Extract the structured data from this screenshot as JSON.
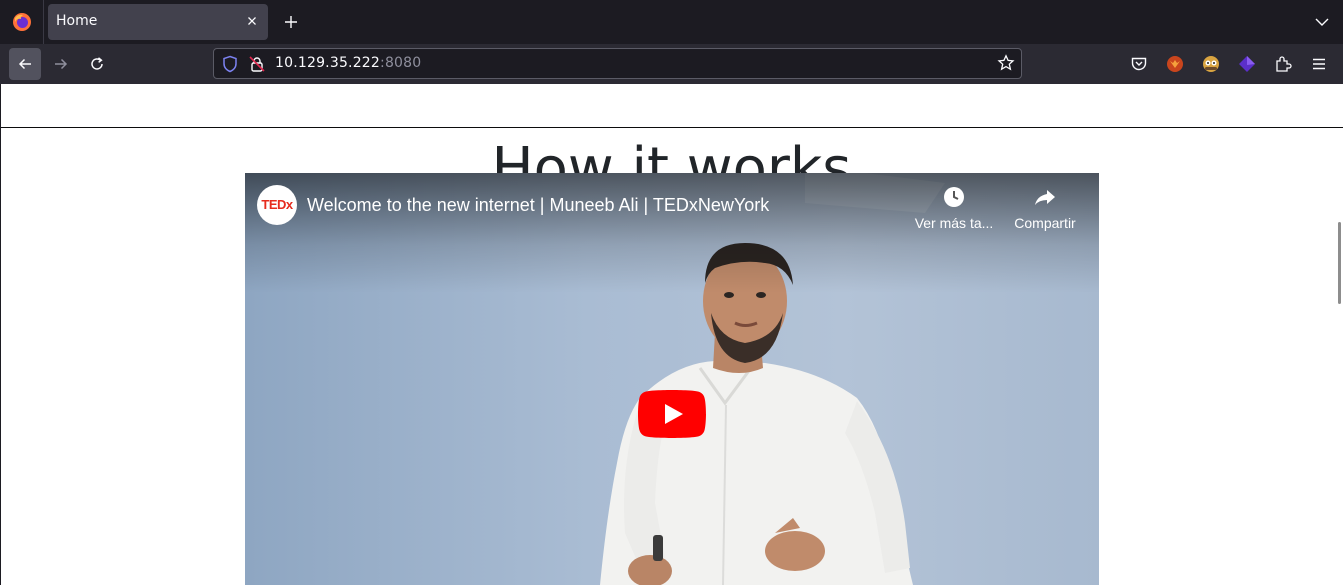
{
  "browser": {
    "tab": {
      "title": "Home"
    },
    "url": {
      "host": "10.129.35.222",
      "port": ":8080"
    }
  },
  "page": {
    "heading": "How it works",
    "video": {
      "channel_logo_text": "TEDx",
      "title": "Welcome to the new internet | Muneeb Ali | TEDxNewYork",
      "watch_later_label": "Ver más ta...",
      "share_label": "Compartir"
    }
  },
  "colors": {
    "tab_strip": "#1c1b22",
    "nav_bar": "#2b2a33",
    "youtube_red": "#ff0000",
    "ted_red": "#e62b1e"
  }
}
